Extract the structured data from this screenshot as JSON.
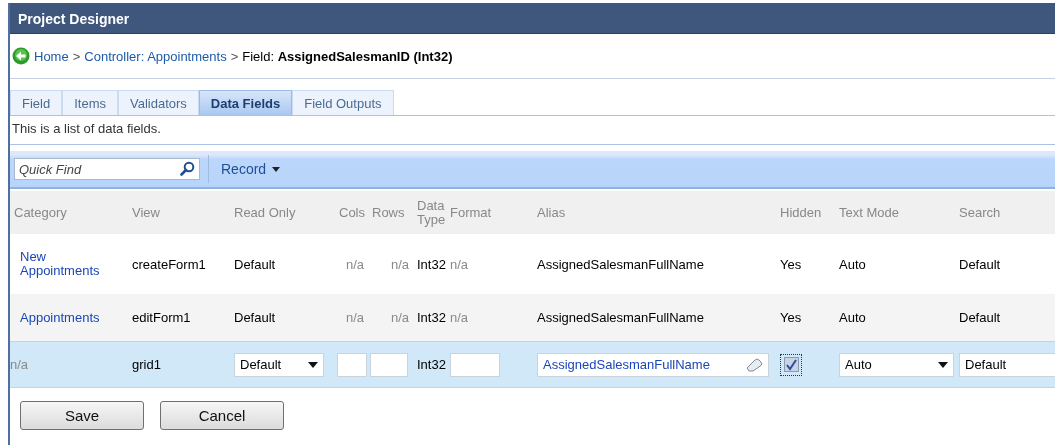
{
  "window": {
    "title": "Project Designer"
  },
  "breadcrumb": [
    {
      "kind": "back"
    },
    {
      "kind": "link",
      "text": "Home"
    },
    {
      "kind": "sep",
      "text": ">"
    },
    {
      "kind": "link",
      "text": "Controller: Appointments"
    },
    {
      "kind": "sep",
      "text": ">"
    },
    {
      "kind": "current",
      "text": "Field: **AssignedSalesmanID (Int32)**"
    }
  ],
  "tabs": [
    {
      "label": "Field",
      "selected": false
    },
    {
      "label": "Items",
      "selected": false
    },
    {
      "label": "Validators",
      "selected": false
    },
    {
      "label": "Data Fields",
      "selected": true
    },
    {
      "label": "Field Outputs",
      "selected": false
    }
  ],
  "description": "This is a list of data fields.",
  "toolbar": {
    "quick_find": {
      "placeholder": "Quick Find"
    },
    "menu": "Record"
  },
  "table": {
    "columns": [
      {
        "label": "Category"
      },
      {
        "label": "View"
      },
      {
        "label": "Read Only"
      },
      {
        "label": "Cols"
      },
      {
        "label": "Rows"
      },
      {
        "label": "Data Type"
      },
      {
        "label": "Format"
      },
      {
        "label": "Alias"
      },
      {
        "label": "Hidden"
      },
      {
        "label": "Text Mode"
      },
      {
        "label": "Search"
      }
    ],
    "rows": [
      {
        "selected": false,
        "cells": [
          {
            "kind": "link",
            "text": "New Appointments"
          },
          {
            "kind": "text",
            "text": "createForm1"
          },
          {
            "kind": "text",
            "text": "Default"
          },
          {
            "kind": "muted",
            "text": "n/a"
          },
          {
            "kind": "muted",
            "text": "n/a"
          },
          {
            "kind": "text",
            "text": "Int32"
          },
          {
            "kind": "muted",
            "text": "n/a"
          },
          {
            "kind": "text",
            "text": "AssignedSalesmanFullName"
          },
          {
            "kind": "text",
            "text": "Yes"
          },
          {
            "kind": "text",
            "text": "Auto"
          },
          {
            "kind": "text",
            "text": "Default"
          }
        ]
      },
      {
        "selected": false,
        "cells": [
          {
            "kind": "link",
            "text": "Appointments"
          },
          {
            "kind": "text",
            "text": "editForm1"
          },
          {
            "kind": "text",
            "text": "Default"
          },
          {
            "kind": "muted",
            "text": "n/a"
          },
          {
            "kind": "muted",
            "text": "n/a"
          },
          {
            "kind": "text",
            "text": "Int32"
          },
          {
            "kind": "muted",
            "text": "n/a"
          },
          {
            "kind": "text",
            "text": "AssignedSalesmanFullName"
          },
          {
            "kind": "text",
            "text": "Yes"
          },
          {
            "kind": "text",
            "text": "Auto"
          },
          {
            "kind": "text",
            "text": "Default"
          }
        ]
      },
      {
        "selected": true,
        "cells": [
          {
            "kind": "muted",
            "text": "n/a"
          },
          {
            "kind": "text",
            "text": "grid1"
          },
          {
            "kind": "select",
            "text": "Default"
          },
          {
            "kind": "input"
          },
          {
            "kind": "input"
          },
          {
            "kind": "text",
            "text": "Int32"
          },
          {
            "kind": "input"
          },
          {
            "kind": "clearable",
            "text": "AssignedSalesmanFullName"
          },
          {
            "kind": "checkbox",
            "checked": true
          },
          {
            "kind": "select",
            "text": "Auto"
          },
          {
            "kind": "input",
            "text": "Default"
          }
        ]
      }
    ]
  },
  "buttons": [
    "Save",
    "Cancel"
  ]
}
